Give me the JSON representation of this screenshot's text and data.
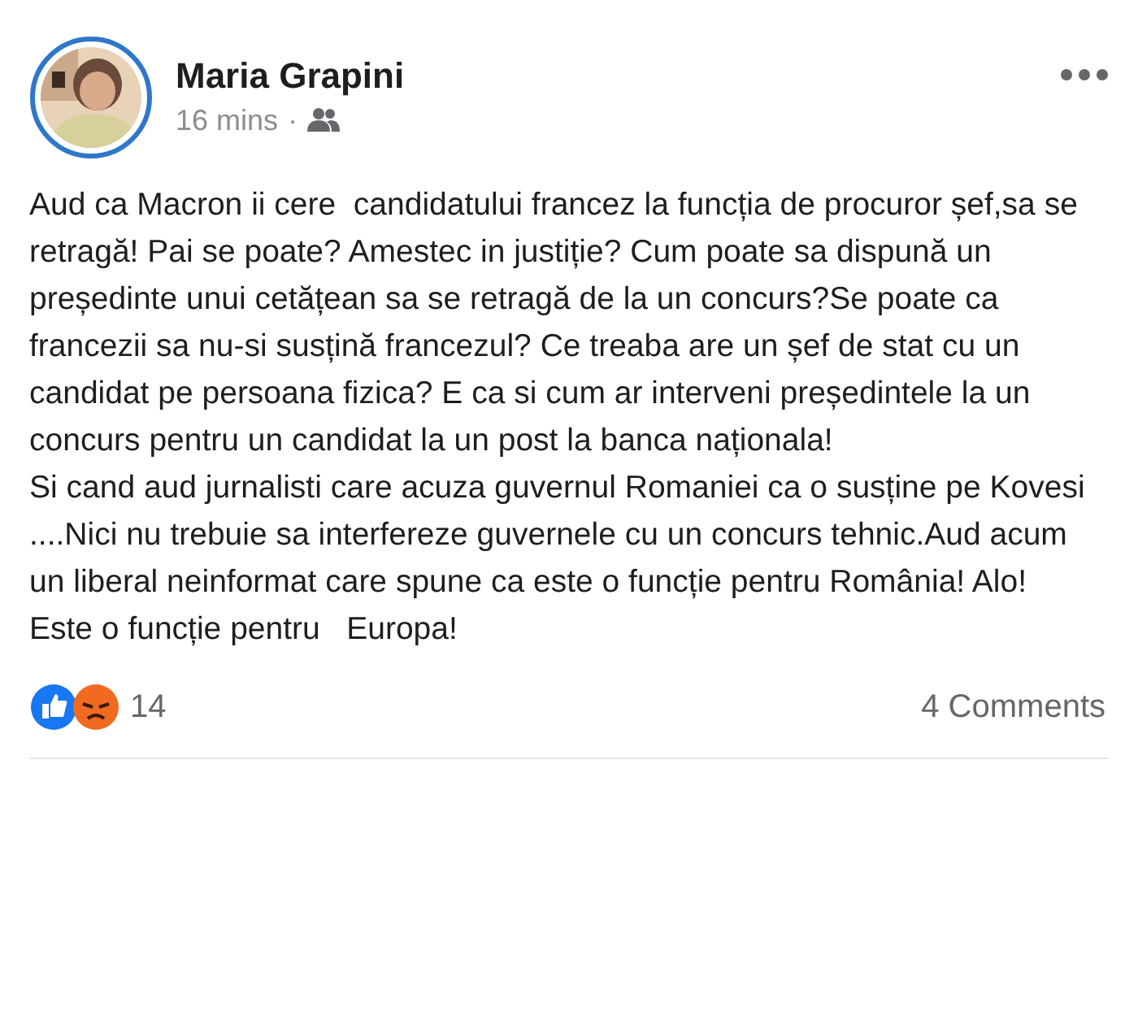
{
  "post": {
    "author": "Maria Grapini",
    "time": "16 mins",
    "separator": "·",
    "paragraphs": [
      "Aud ca Macron ii cere  candidatului francez la funcția de procuror șef,sa se retragă! Pai se poate? Amestec in justiție? Cum poate sa dispună un președinte unui cetățean sa se retragă de la un concurs?Se poate ca francezii sa nu-si susțină francezul? Ce treaba are un șef de stat cu un candidat pe persoana fizica? E ca si cum ar interveni președintele la un concurs pentru un candidat la un post la banca naționala!",
      "Si cand aud jurnalisti care acuza guvernul Romaniei ca o susține pe Kovesi ....Nici nu trebuie sa interfereze guvernele cu un concurs tehnic.Aud acum un liberal neinformat care spune ca este o funcție pentru România! Alo! Este o funcție pentru   Europa!"
    ],
    "reaction_count": "14",
    "comments": "4 Comments"
  }
}
